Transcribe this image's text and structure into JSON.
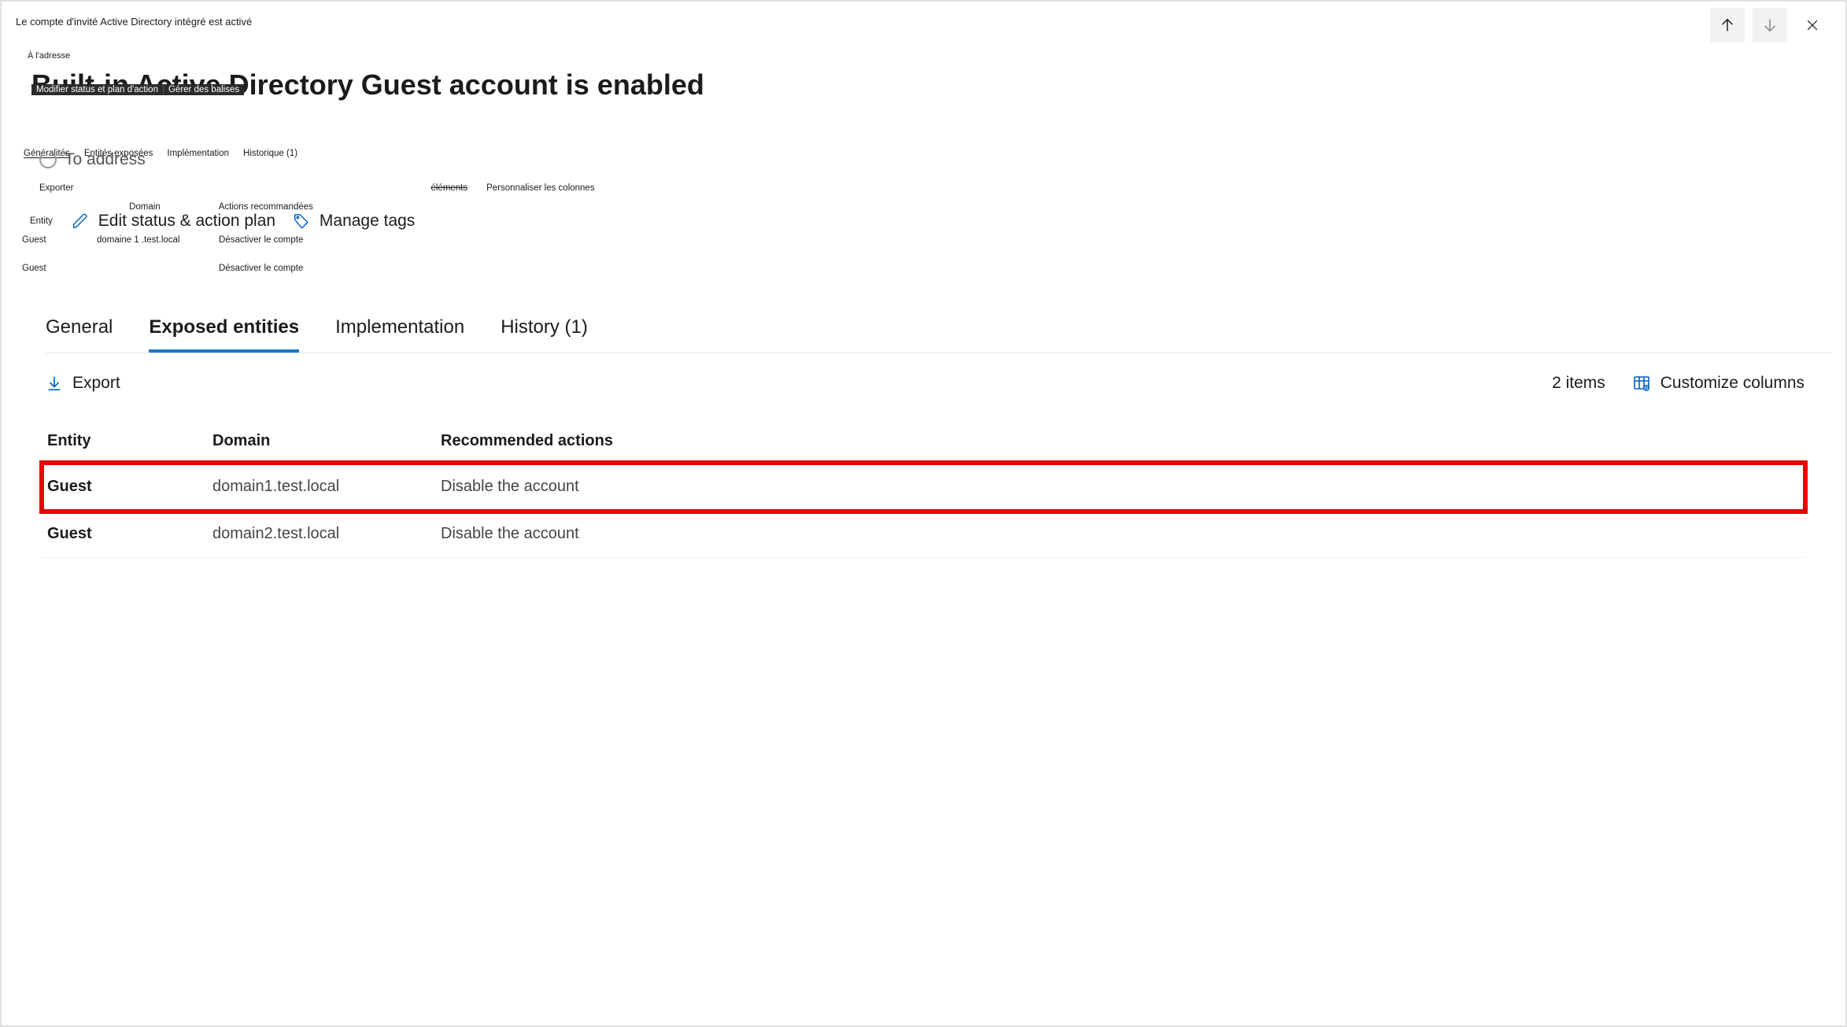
{
  "header": {
    "subtitle_fr": "Le compte d'invité Active Directory intégré est activé",
    "at_address_fr": "À l'adresse",
    "title": "Built-in Active Directory Guest account is enabled",
    "tooltip_edit_fr": "Modifier status et plan d'action",
    "tooltip_tags_fr": "Gérer des balises",
    "to_address": "To address"
  },
  "fr_tabs": {
    "general": "Généralités",
    "exposed": "Entités exposées",
    "implementation": "Implémentation",
    "history": "Historique (1)"
  },
  "fr_toolbar": {
    "export": "Exporter",
    "items": "éléments",
    "customize": "Personnaliser les colonnes"
  },
  "actions": {
    "entity_label_fr": "Entity",
    "domain_label_fr": "Domain",
    "recommended_label_fr": "Actions recommandées",
    "edit_status_label": "Edit status & action plan",
    "manage_tags_label": "Manage tags"
  },
  "mini_rows": [
    {
      "entity": "Guest",
      "domain": "domaine 1 .test.local",
      "action": "Désactiver le compte"
    },
    {
      "entity": "Guest",
      "domain": "",
      "action": "Désactiver le compte"
    }
  ],
  "tabs": {
    "general": "General",
    "exposed": "Exposed entities",
    "implementation": "Implementation",
    "history": "History (1)"
  },
  "toolbar": {
    "export": "Export",
    "items_count": "2 items",
    "customize": "Customize columns"
  },
  "table": {
    "headers": {
      "entity": "Entity",
      "domain": "Domain",
      "actions": "Recommended actions"
    },
    "rows": [
      {
        "entity": "Guest",
        "domain": "domain1.test.local",
        "action": "Disable the account",
        "highlight": true
      },
      {
        "entity": "Guest",
        "domain": "domain2.test.local",
        "action": "Disable the account",
        "highlight": false
      }
    ]
  }
}
